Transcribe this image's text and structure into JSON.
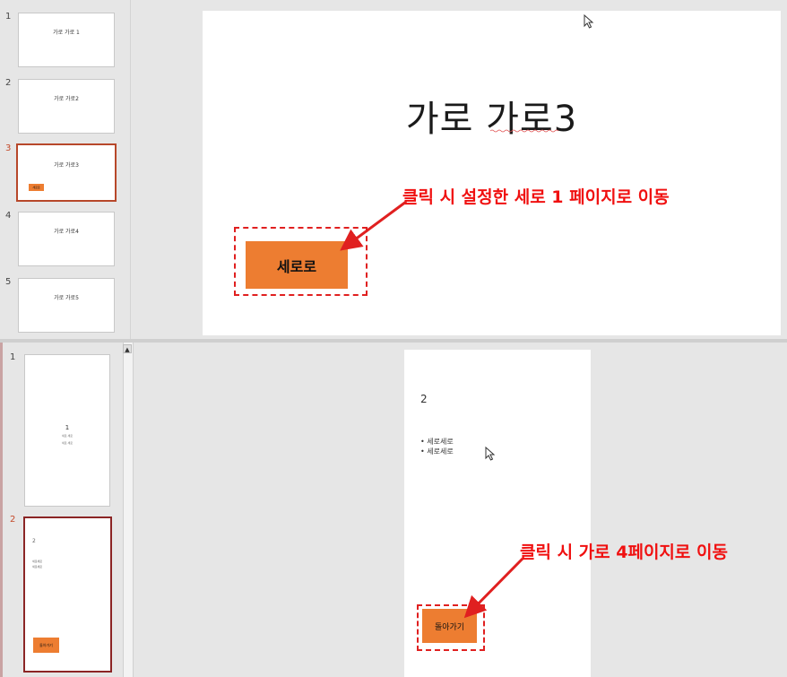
{
  "top": {
    "thumbnails": [
      {
        "num": "1",
        "title": "가로 가로 1"
      },
      {
        "num": "2",
        "title": "가로 가로2"
      },
      {
        "num": "3",
        "title": "가로 가로3",
        "selected": true,
        "button_label": "세로로"
      },
      {
        "num": "4",
        "title": "가로 가로4"
      },
      {
        "num": "5",
        "title": "가로 가로5"
      }
    ],
    "slide_title": "가로 가로3",
    "button_label": "세로로",
    "annotation": "클릭 시 설정한 세로 1 페이지로 이동"
  },
  "bottom": {
    "thumbnails": [
      {
        "num": "1",
        "slide_number": "1",
        "lines": [
          "세로 세로",
          "세로 세로"
        ]
      },
      {
        "num": "2",
        "selected": true,
        "slide_number": "2",
        "bullets": [
          "세로세로",
          "세로세로"
        ],
        "button_label": "돌아가기"
      }
    ],
    "slide_number": "2",
    "bullets": [
      "세로세로",
      "세로세로"
    ],
    "button_label": "돌아가기",
    "annotation": "클릭 시 가로 4페이지로 이동"
  },
  "colors": {
    "accent_orange": "#ed7d31",
    "annotation_red": "#f01010",
    "selection_border": "#b7472a",
    "pane_background": "#e6e6e6"
  },
  "icons": [
    "mouse-cursor-icon",
    "scroll-up-arrow-icon",
    "annotation-arrow-icon"
  ]
}
